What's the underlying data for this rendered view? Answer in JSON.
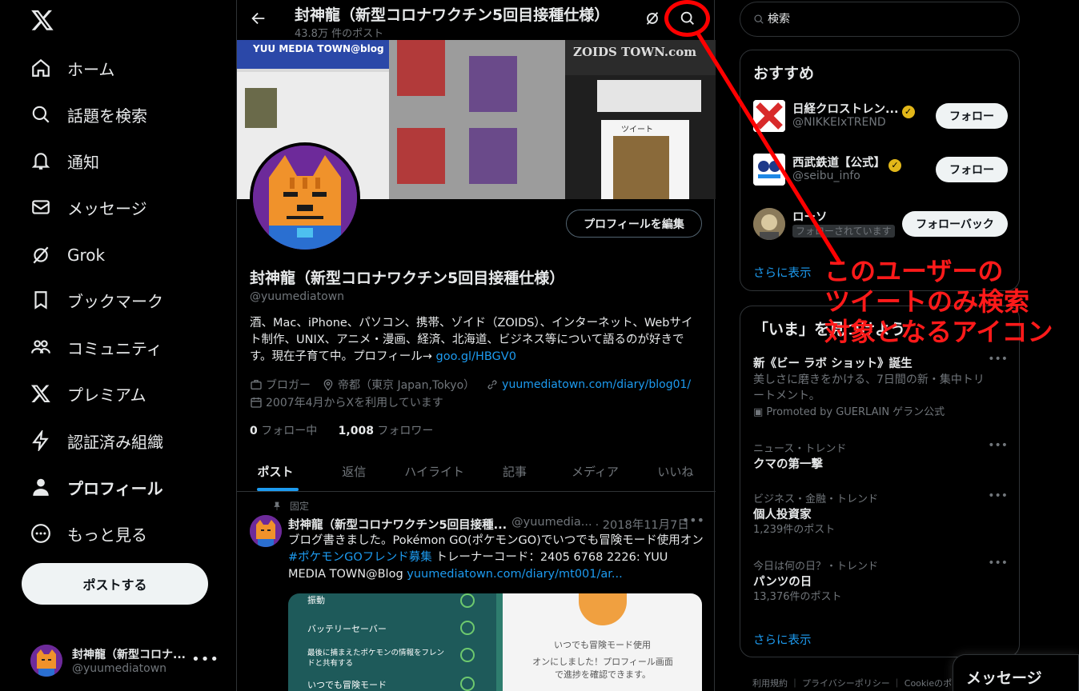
{
  "nav": {
    "items": [
      {
        "label": "ホーム",
        "icon": "home-icon"
      },
      {
        "label": "話題を検索",
        "icon": "search-icon"
      },
      {
        "label": "通知",
        "icon": "bell-icon"
      },
      {
        "label": "メッセージ",
        "icon": "mail-icon"
      },
      {
        "label": "Grok",
        "icon": "grok-icon"
      },
      {
        "label": "ブックマーク",
        "icon": "bookmark-icon"
      },
      {
        "label": "コミュニティ",
        "icon": "communities-icon"
      },
      {
        "label": "プレミアム",
        "icon": "x-logo-icon"
      },
      {
        "label": "認証済み組織",
        "icon": "lightning-icon"
      },
      {
        "label": "プロフィール",
        "icon": "person-icon"
      },
      {
        "label": "もっと見る",
        "icon": "more-circle-icon"
      }
    ],
    "post_button": "ポストする"
  },
  "account": {
    "name": "封神龍（新型コロナ...",
    "handle": "@yuumediatown"
  },
  "topbar": {
    "title": "封神龍（新型コロナワクチン5回目接種仕様）",
    "post_count": "43.8万 件のポスト"
  },
  "banner": {
    "blog_title": "YUU MEDIA TOWN@blog",
    "site_title": "ZOIDS TOWN.com",
    "tweet_label": "ツイート"
  },
  "profile": {
    "edit_button": "プロフィールを編集",
    "name": "封神龍（新型コロナワクチン5回目接種仕様）",
    "handle": "@yuumediatown",
    "bio": "酒、Mac、iPhone、パソコン、携帯、ゾイド（ZOIDS）、インターネット、Webサイト制作、UNIX、アニメ・漫画、経済、北海道、ビジネス等について語るのが好きです。現在子育て中。プロフィール→ ",
    "bio_link": "goo.gl/HBGV0",
    "category": "ブロガー",
    "location": "帝都（東京 Japan,Tokyo）",
    "website": "yuumediatown.com/diary/blog01/",
    "joined": "2007年4月からXを利用しています",
    "following_count": "0",
    "following_label": "フォロー中",
    "followers_count": "1,008",
    "followers_label": "フォロワー"
  },
  "tabs": [
    "ポスト",
    "返信",
    "ハイライト",
    "記事",
    "メディア",
    "いいね"
  ],
  "tweet": {
    "pinned_label": "固定",
    "author": "封神龍（新型コロナワクチン5回目接種...",
    "handle": "@yuumedia...",
    "date": "· 2018年11月7日",
    "text_1": "ブログ書きました。Pokémon GO(ポケモンGO)でいつでも冒険モード使用オン ",
    "hashtag": "#ポケモンGOフレンド募集",
    "text_2": " トレーナーコード：2405 6768 2226: YUU MEDIA TOWN@Blog ",
    "link": "yuumediatown.com/diary/mt001/ar...",
    "media_rows": [
      "振動",
      "バッテリーセーバー",
      "最後に捕まえたポケモンの情報をフレンドと共有する",
      "いつでも冒険モード"
    ],
    "media_right_1": "いつでも冒険モード使用",
    "media_right_2": "オンにしました！プロフィール画面で進捗を確認できます。"
  },
  "search": {
    "placeholder": "検索"
  },
  "recommend": {
    "title": "おすすめ",
    "items": [
      {
        "name": "日経クロストレン...",
        "handle": "@NIKKEIxTREND",
        "button": "フォロー"
      },
      {
        "name": "西武鉄道【公式】",
        "handle": "@seibu_info",
        "button": "フォロー"
      },
      {
        "name": "ローソ",
        "handle": "フォローされています",
        "button": "フォローバック"
      }
    ],
    "more": "さらに表示"
  },
  "trends": {
    "title": "「いま」を見つけよう",
    "items": [
      {
        "title": "新《ビー ラボ ショット》誕生",
        "desc": "美しさに磨きをかける、7日間の新・集中トリートメント。",
        "promo": "Promoted by GUERLAIN ゲラン公式"
      },
      {
        "category": "ニュース・トレンド",
        "title": "クマの第一撃"
      },
      {
        "category": "ビジネス・金融・トレンド",
        "title": "個人投資家",
        "count": "1,239件のポスト"
      },
      {
        "category": "今日は何の日？・トレンド",
        "title": "パンツの日",
        "count": "13,376件のポスト"
      }
    ],
    "more": "さらに表示"
  },
  "footer": {
    "links": "利用規約 ｜ プライバシーポリシー ｜ Cookieのポ"
  },
  "messages_drawer": "メッセージ",
  "annotation": {
    "text": "このユーザーの\nツイートのみ検索\n対象となるアイコン",
    "color": "#ff0000"
  },
  "colors": {
    "accent": "#1d9bf0",
    "background": "#000000",
    "border": "#2f3336",
    "muted": "#71767b",
    "verified": "#e2b719"
  }
}
